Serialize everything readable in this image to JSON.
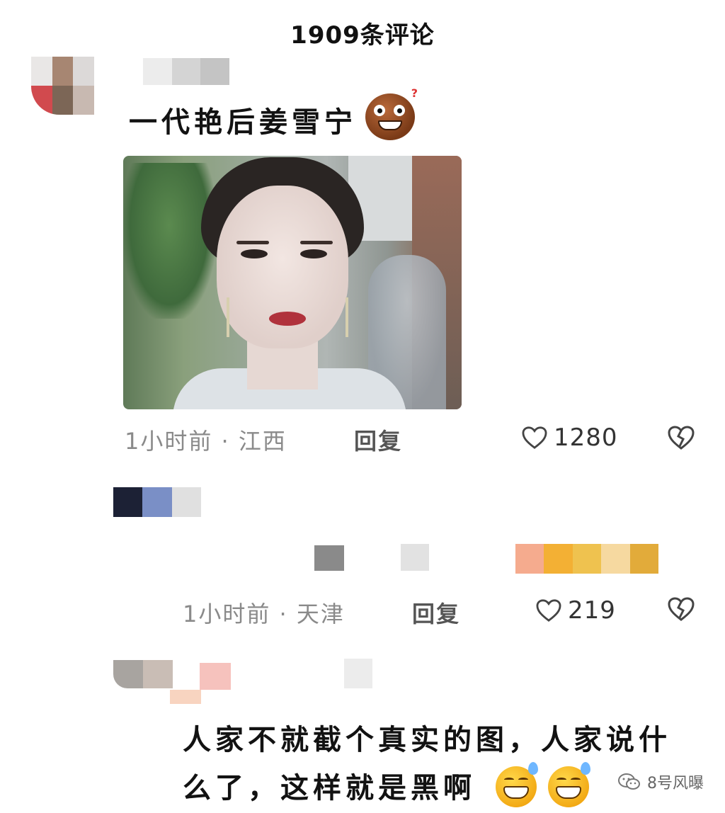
{
  "header": {
    "title": "1909条评论"
  },
  "comments": [
    {
      "text": "一代艳后姜雪宁",
      "time": "1小时前",
      "location": "江西",
      "meta_separator": " · ",
      "reply_label": "回复",
      "likes": "1280"
    },
    {
      "time": "1小时前",
      "location": "天津",
      "meta_separator": " · ",
      "reply_label": "回复",
      "likes": "219"
    },
    {
      "text_line1": "人家不就截个真实的图，人家说什",
      "text_line2": "么了，这样就是黑啊"
    }
  ],
  "watermark": {
    "text": "8号风曝"
  },
  "icons": {
    "like": "heart-outline-icon",
    "dislike": "broken-heart-icon",
    "emoji_1": "cookie-face-emoji-icon",
    "emoji_3": "grin-sweat-emoji-icon",
    "watermark": "wechat-icon"
  },
  "colors": {
    "meta": "#8a8a8a",
    "text": "#121212",
    "heart_stroke": "#444444"
  }
}
